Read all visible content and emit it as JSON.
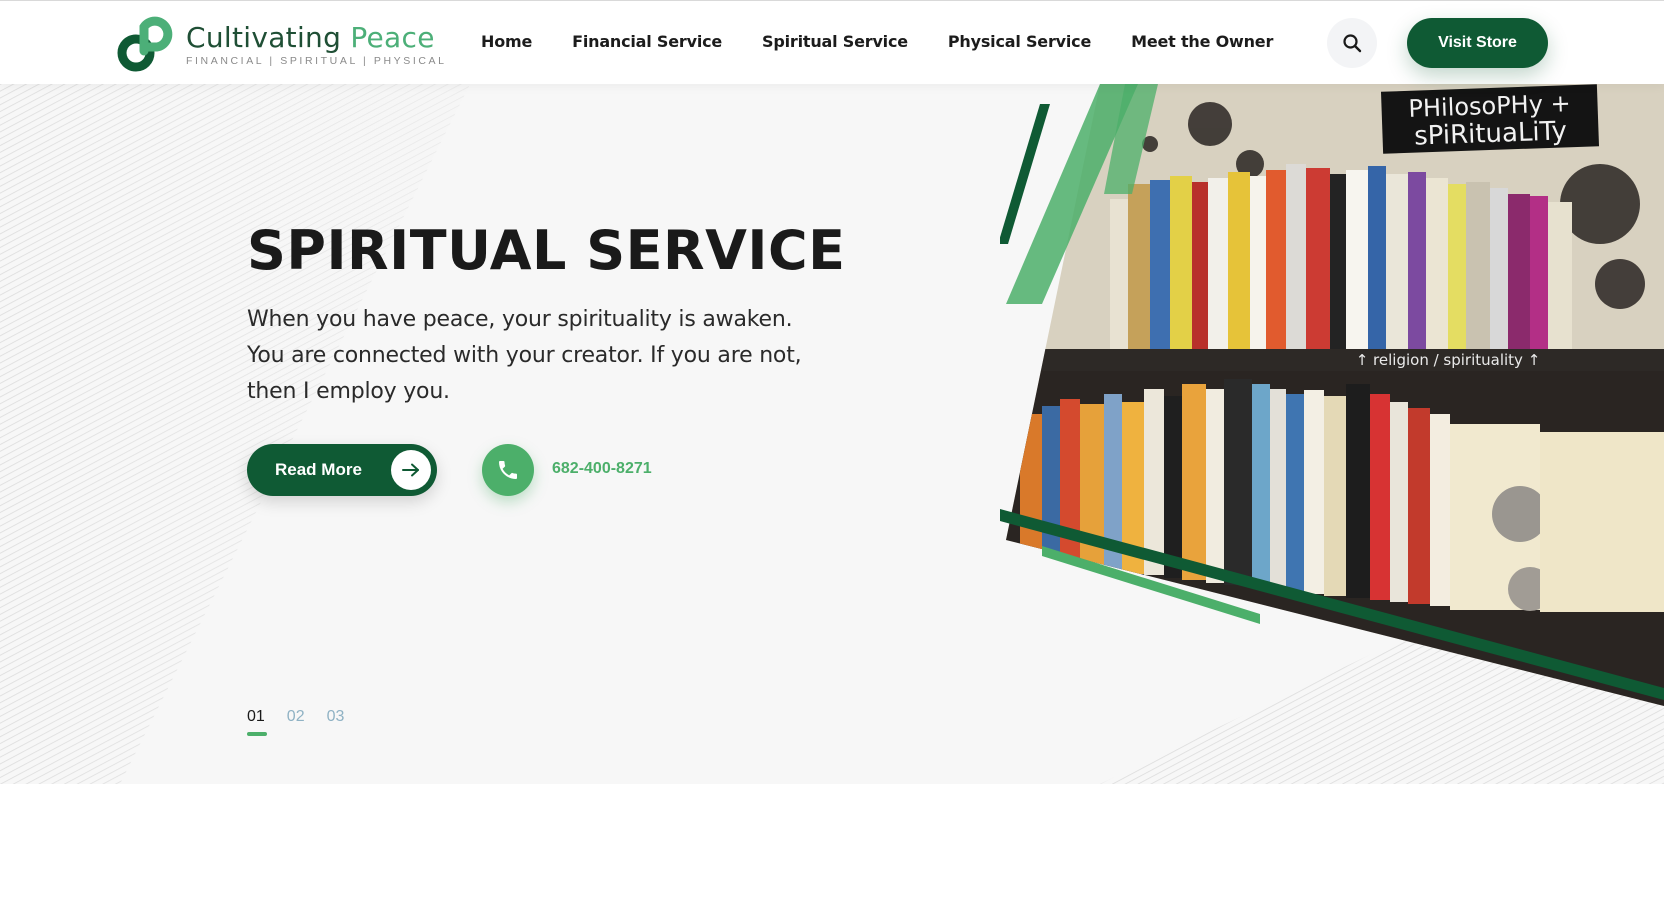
{
  "brand": {
    "name_part1": "Cultivating",
    "name_part2": "Peace",
    "tagline": "FINANCIAL | SPIRITUAL | PHYSICAL",
    "primary_color": "#0f5a34",
    "accent_color": "#4caf6a"
  },
  "nav": {
    "items": [
      {
        "label": "Home"
      },
      {
        "label": "Financial Service"
      },
      {
        "label": "Spiritual Service"
      },
      {
        "label": "Physical Service"
      },
      {
        "label": "Meet the Owner"
      }
    ],
    "search_icon": "search-icon",
    "store_label": "Visit Store"
  },
  "hero": {
    "title": "SPIRITUAL SERVICE",
    "description": "When you have peace, your spirituality is awaken. You are connected with your creator. If you are not, then I employ you.",
    "read_more_label": "Read More",
    "phone": "682-400-8271",
    "image_sign_top": "PHilosoPHy + sPiRituaLiTy",
    "image_sign_shelf": "↑ religion / spirituality ↑",
    "pager": [
      {
        "label": "01",
        "active": true
      },
      {
        "label": "02",
        "active": false
      },
      {
        "label": "03",
        "active": false
      }
    ]
  }
}
